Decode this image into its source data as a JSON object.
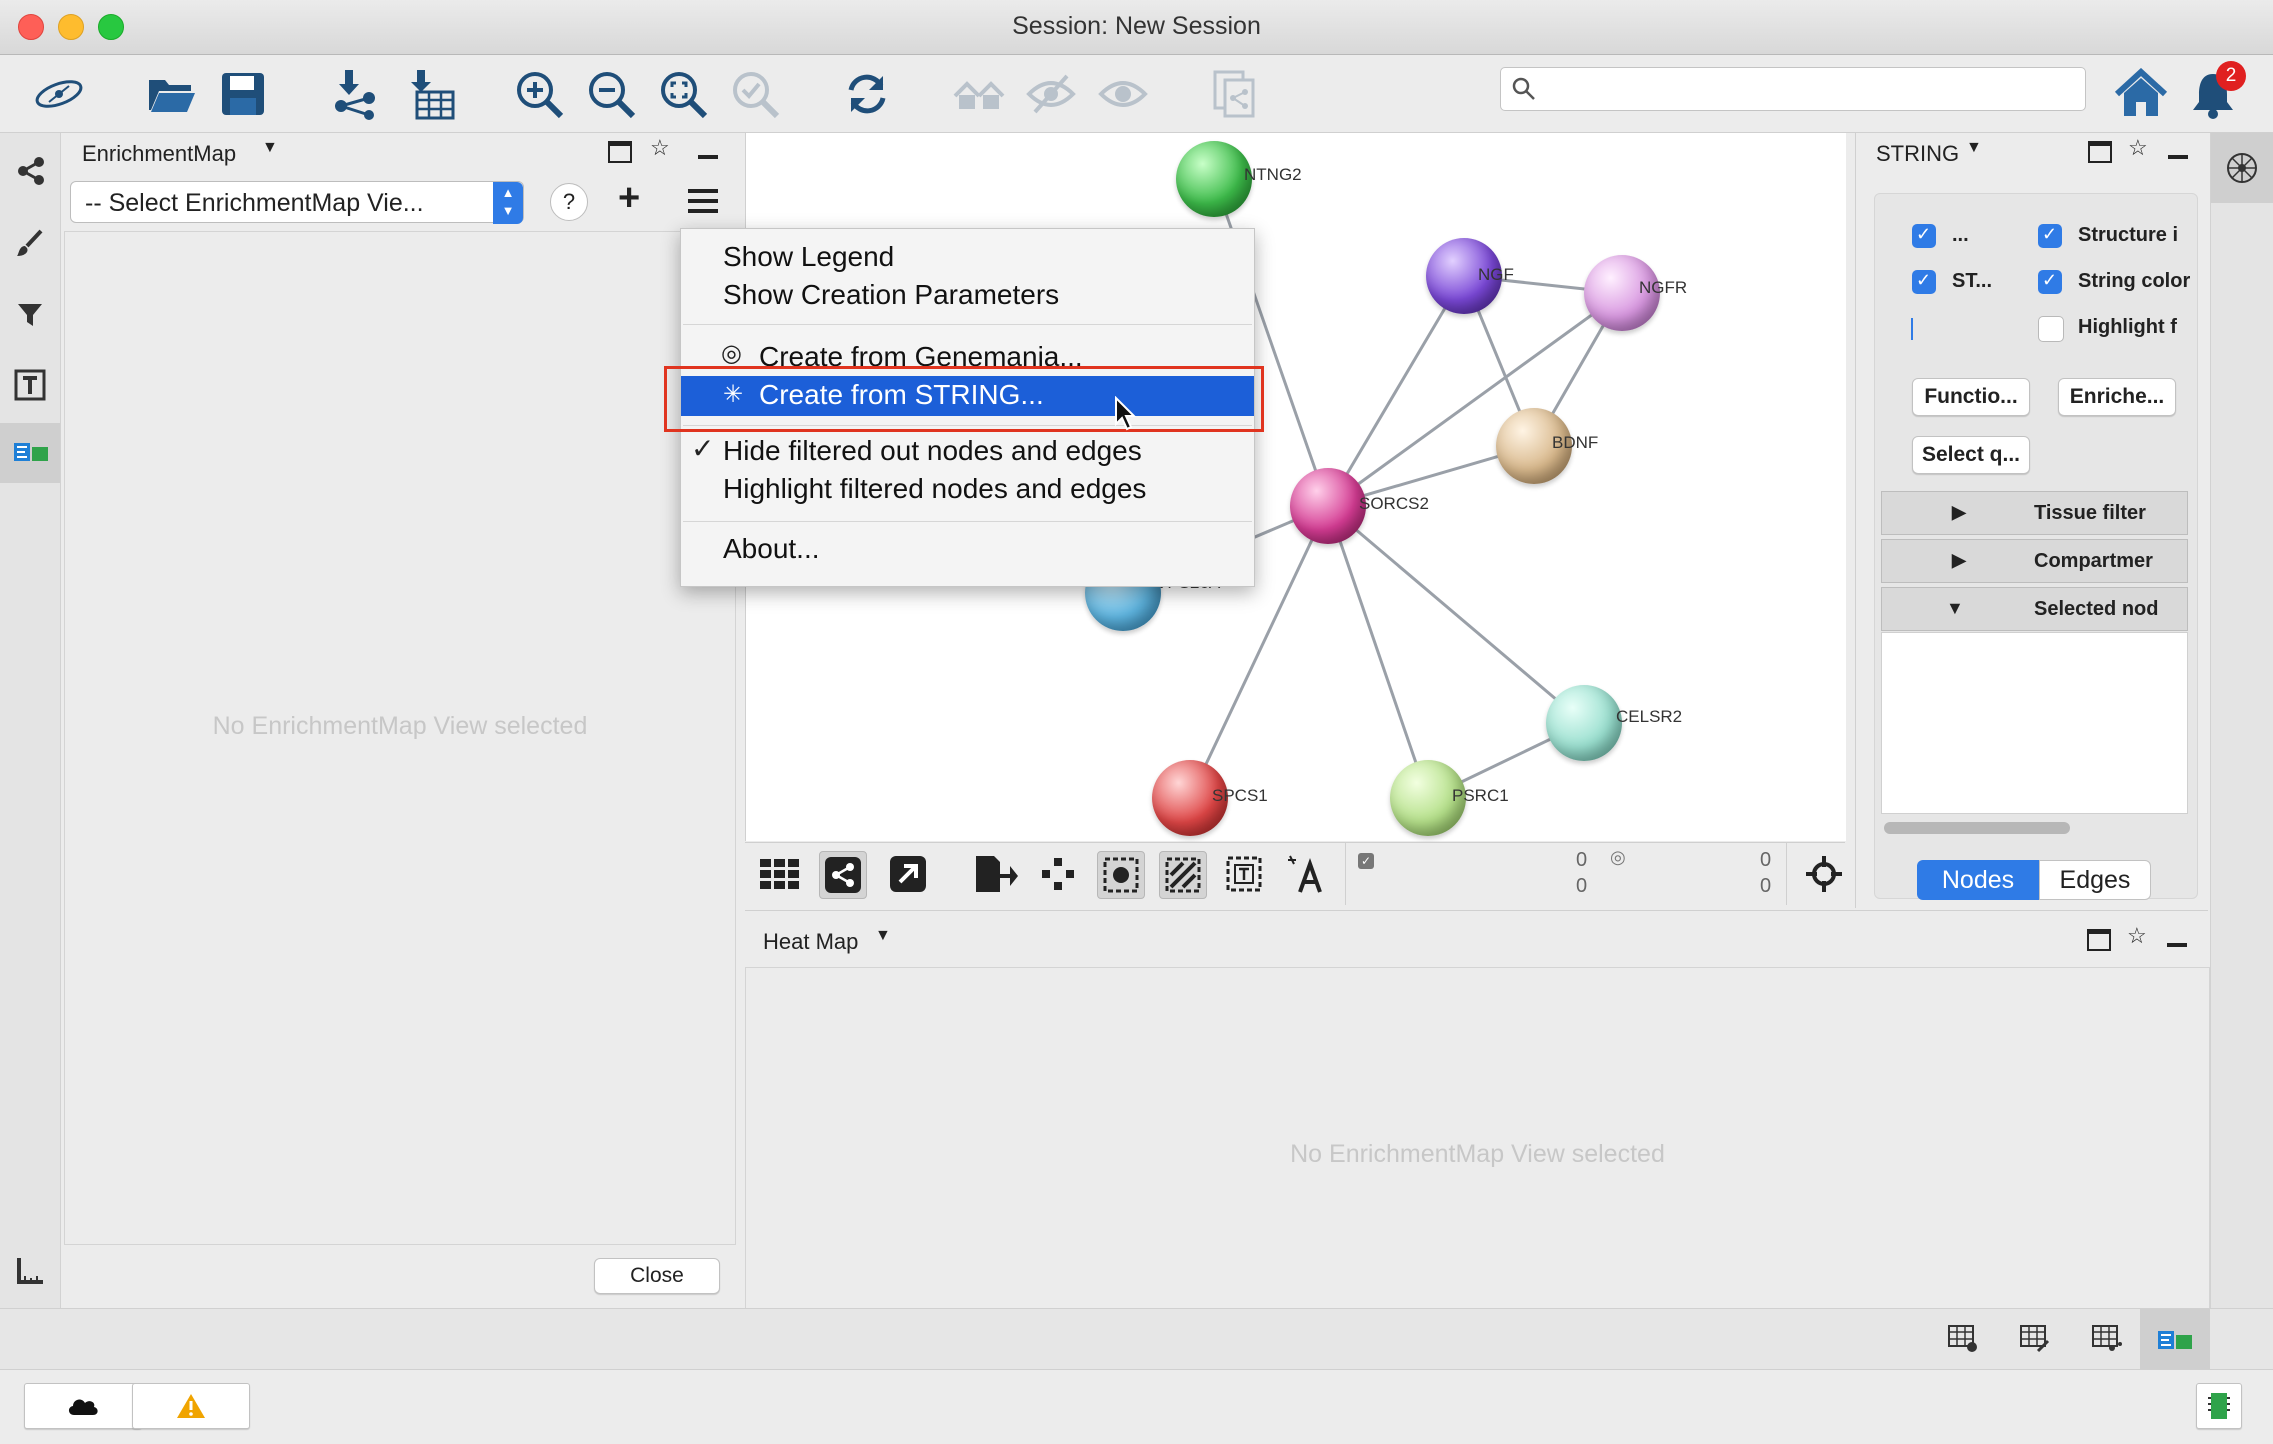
{
  "window": {
    "title": "Session: New Session"
  },
  "toolbar": {
    "search_placeholder": "",
    "notification_count": "2",
    "icons": [
      "cytoscape-logo-icon",
      "open-session-icon",
      "save-session-icon",
      "import-network-icon",
      "import-table-icon",
      "zoom-in-icon",
      "zoom-out-icon",
      "zoom-fit-icon",
      "zoom-selected-icon",
      "refresh-icon",
      "home-hide-icon",
      "hide-icon",
      "show-icon",
      "export-icon",
      "home-icon",
      "notification-bell-icon"
    ]
  },
  "left_panel": {
    "title": "EnrichmentMap",
    "selector_value": "-- Select EnrichmentMap Vie...",
    "help_label": "?",
    "add_label": "+",
    "empty_message": "No EnrichmentMap View selected",
    "close_button": "Close"
  },
  "context_menu": {
    "items": [
      {
        "label": "Show Legend"
      },
      {
        "label": "Show Creation Parameters"
      },
      {
        "label": "Create from Genemania..."
      },
      {
        "label": "Create from STRING..."
      },
      {
        "label": "Hide filtered out nodes and edges",
        "checked": true
      },
      {
        "label": "Highlight filtered nodes and edges"
      },
      {
        "label": "About..."
      }
    ],
    "highlighted_index": 3
  },
  "network": {
    "nodes": [
      "NTNG2",
      "NGF",
      "NGFR",
      "BDNF",
      "SORCS2",
      "VPS26A",
      "CELSR2",
      "SPCS1",
      "PSRC1"
    ],
    "selected_counts": {
      "nodes_selected": "0",
      "nodes_hidden": "0",
      "edges_selected": "0",
      "edges_hidden": "0"
    }
  },
  "string_panel": {
    "title": "STRING",
    "checkboxes": [
      {
        "label": "...",
        "checked": true
      },
      {
        "label": "Structure i",
        "checked": true
      },
      {
        "label": "ST...",
        "checked": true
      },
      {
        "label": "String color",
        "checked": true
      },
      {
        "label": "Highlight f",
        "checked": false
      }
    ],
    "buttons": [
      "Functio...",
      "Enriche...",
      "Select q..."
    ],
    "sections": [
      {
        "label": "Tissue filter",
        "expanded": false
      },
      {
        "label": "Compartmer",
        "expanded": false
      },
      {
        "label": "Selected nod",
        "expanded": true
      }
    ],
    "tabs": [
      "Nodes",
      "Edges"
    ],
    "active_tab": "Nodes"
  },
  "heatmap_panel": {
    "title": "Heat Map",
    "empty_message": "No EnrichmentMap View selected"
  },
  "colors": {
    "accent": "#1c5fd8",
    "highlight_outline": "#e0341f",
    "badge": "#e02020"
  }
}
